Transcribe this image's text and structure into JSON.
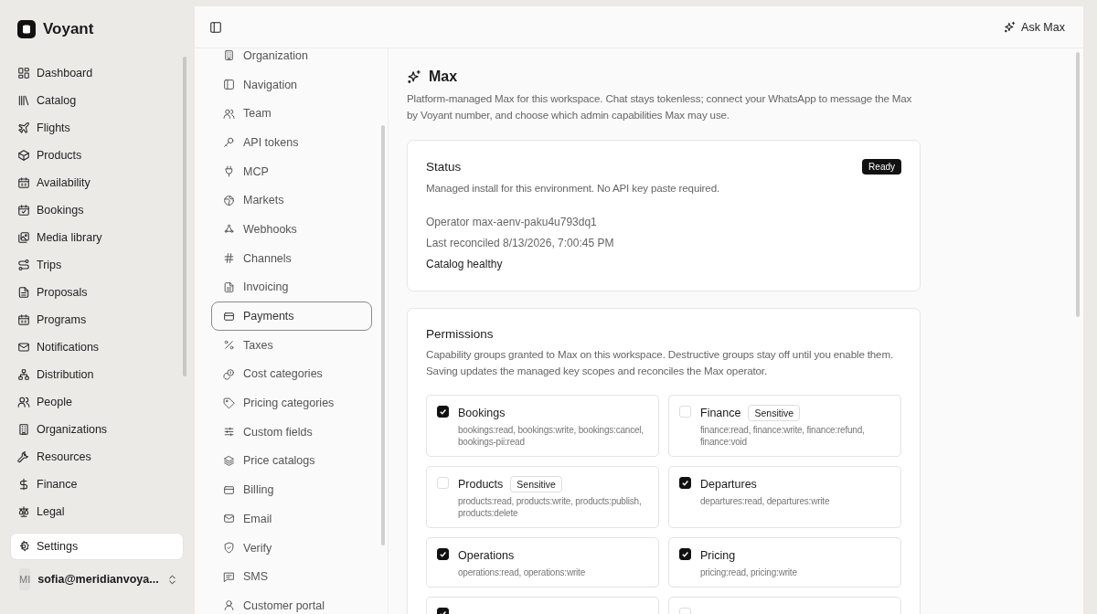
{
  "brand": {
    "name": "Voyant"
  },
  "sidebar": {
    "items": [
      {
        "label": "Dashboard",
        "selected": false
      },
      {
        "label": "Catalog",
        "selected": false
      },
      {
        "label": "Flights",
        "selected": false
      },
      {
        "label": "Products",
        "selected": false
      },
      {
        "label": "Availability",
        "selected": false
      },
      {
        "label": "Bookings",
        "selected": false
      },
      {
        "label": "Media library",
        "selected": false
      },
      {
        "label": "Trips",
        "selected": false
      },
      {
        "label": "Proposals",
        "selected": false
      },
      {
        "label": "Programs",
        "selected": false
      },
      {
        "label": "Notifications",
        "selected": false
      },
      {
        "label": "Distribution",
        "selected": false
      },
      {
        "label": "People",
        "selected": false
      },
      {
        "label": "Organizations",
        "selected": false
      },
      {
        "label": "Resources",
        "selected": false
      },
      {
        "label": "Finance",
        "selected": false
      },
      {
        "label": "Legal",
        "selected": false
      },
      {
        "label": "Settings",
        "selected": true
      }
    ],
    "user": {
      "initials": "MI",
      "email": "sofia@meridianvoya..."
    }
  },
  "topbar": {
    "ask_button": "Ask Max"
  },
  "settings_nav": {
    "items": [
      {
        "label": "Organization",
        "selected": false
      },
      {
        "label": "Navigation",
        "selected": false
      },
      {
        "label": "Team",
        "selected": false
      },
      {
        "label": "API tokens",
        "selected": false
      },
      {
        "label": "MCP",
        "selected": false
      },
      {
        "label": "Markets",
        "selected": false
      },
      {
        "label": "Webhooks",
        "selected": false
      },
      {
        "label": "Channels",
        "selected": false
      },
      {
        "label": "Invoicing",
        "selected": false
      },
      {
        "label": "Payments",
        "selected": true
      },
      {
        "label": "Taxes",
        "selected": false
      },
      {
        "label": "Cost categories",
        "selected": false
      },
      {
        "label": "Pricing categories",
        "selected": false
      },
      {
        "label": "Custom fields",
        "selected": false
      },
      {
        "label": "Price catalogs",
        "selected": false
      },
      {
        "label": "Billing",
        "selected": false
      },
      {
        "label": "Email",
        "selected": false
      },
      {
        "label": "Verify",
        "selected": false
      },
      {
        "label": "SMS",
        "selected": false
      },
      {
        "label": "Customer portal",
        "selected": false
      }
    ]
  },
  "page": {
    "title": "Max",
    "description": "Platform-managed Max for this workspace. Chat stays tokenless; connect your WhatsApp to message the Max by Voyant number, and choose which admin capabilities Max may use."
  },
  "status_card": {
    "title": "Status",
    "badge": "Ready",
    "description": "Managed install for this environment. No API key paste required.",
    "operator": "Operator max-aenv-paku4u793dq1",
    "last_reconciled": "Last reconciled 8/13/2026, 7:00:45 PM",
    "health": "Catalog healthy"
  },
  "permissions": {
    "title": "Permissions",
    "description": "Capability groups granted to Max on this workspace. Destructive groups stay off until you enable them. Saving updates the managed key scopes and reconciles the Max operator.",
    "groups": [
      {
        "name": "Bookings",
        "scopes": "bookings:read, bookings:write, bookings:cancel, bookings-pii:read",
        "checked": true
      },
      {
        "name": "Finance",
        "badge": "Sensitive",
        "scopes": "finance:read, finance:write, finance:refund, finance:void",
        "checked": false
      },
      {
        "name": "Products",
        "badge": "Sensitive",
        "scopes": "products:read, products:write, products:publish, products:delete",
        "checked": false
      },
      {
        "name": "Departures",
        "scopes": "departures:read, departures:write",
        "checked": true
      },
      {
        "name": "Operations",
        "scopes": "operations:read, operations:write",
        "checked": true
      },
      {
        "name": "Pricing",
        "scopes": "pricing:read, pricing:write",
        "checked": true
      },
      {
        "checked": true
      },
      {
        "checked": false
      }
    ]
  }
}
